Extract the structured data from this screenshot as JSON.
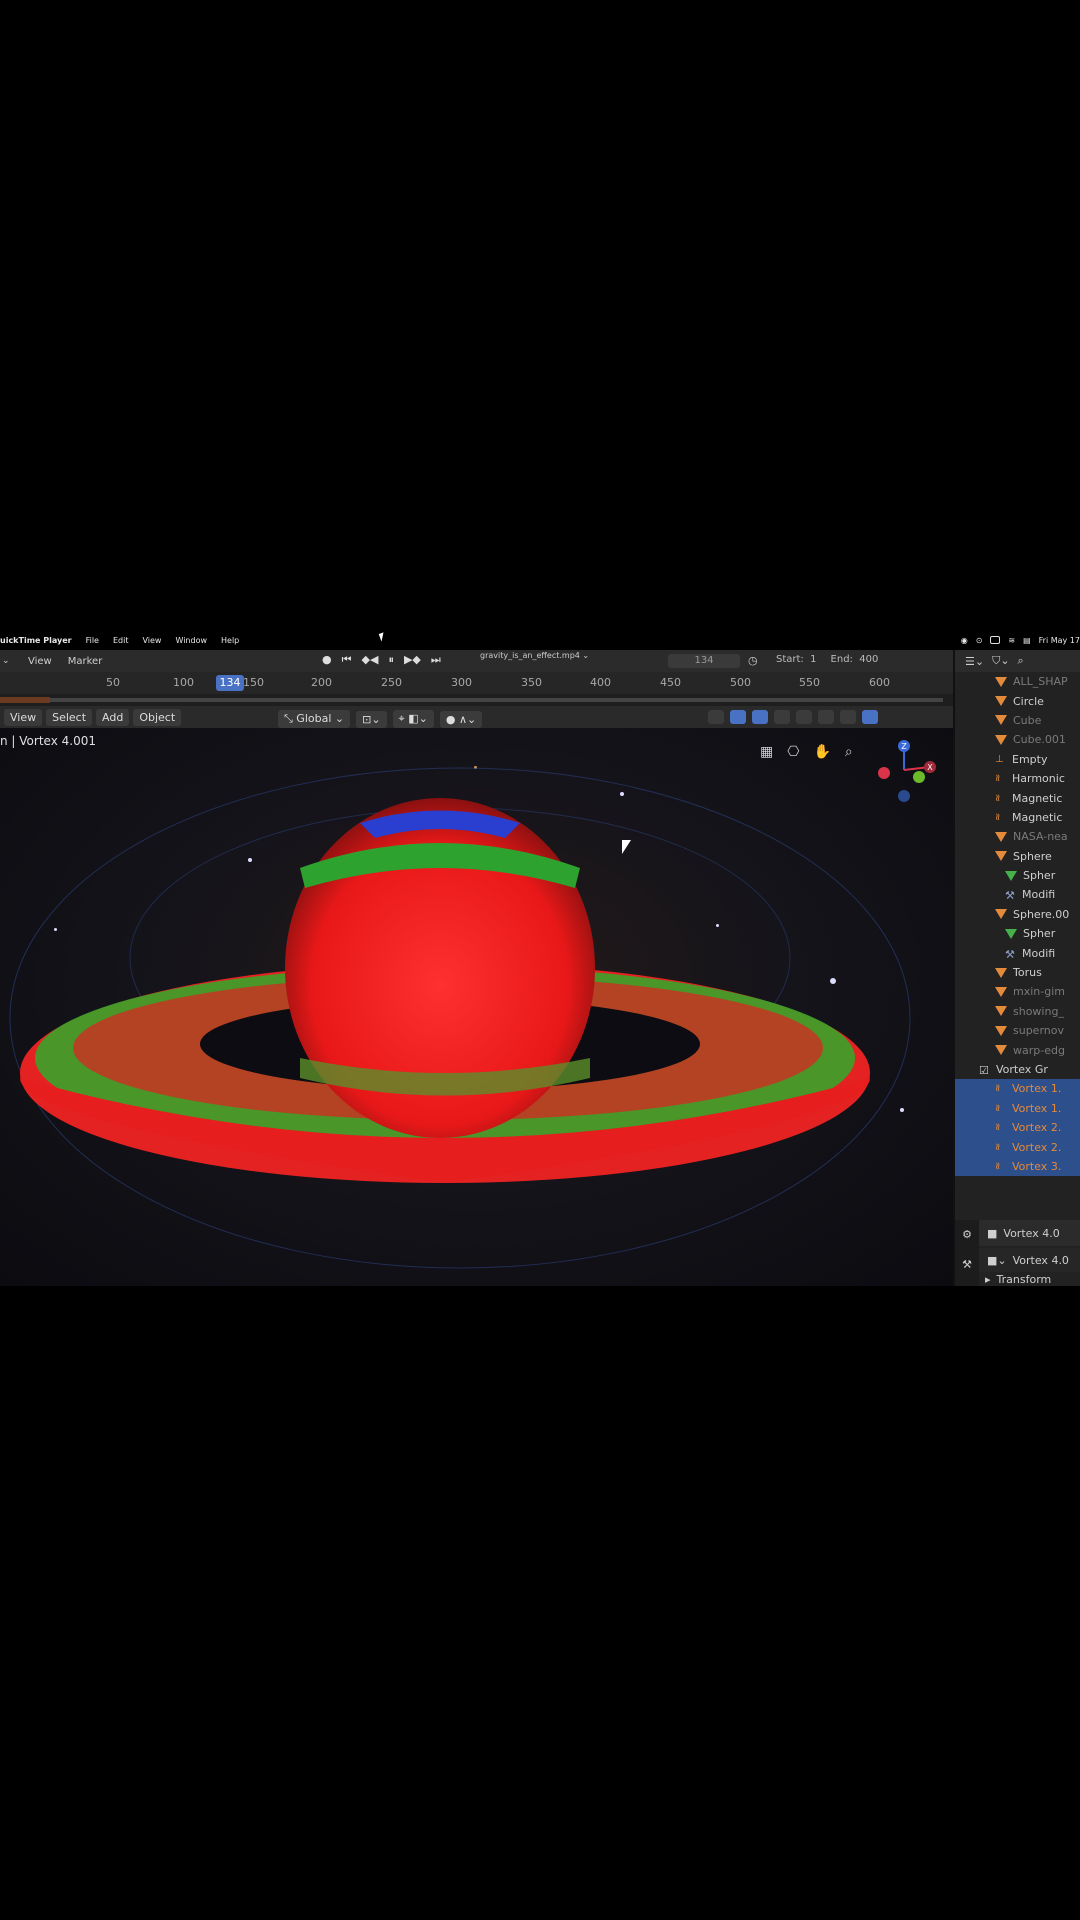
{
  "menubar": {
    "app_name": "uickTime Player",
    "items": [
      "File",
      "Edit",
      "View",
      "Window",
      "Help"
    ],
    "clock": "Fri May 17"
  },
  "video": {
    "file_title": "gravity_is_an_effect.mp4 ⌄",
    "timeline": {
      "view_label": "View",
      "marker_label": "Marker",
      "current_frame": "134",
      "start_label": "Start:",
      "start_value": "1",
      "end_label": "End:",
      "end_value": "400",
      "ruler_ticks": [
        "50",
        "100",
        "150",
        "200",
        "250",
        "300",
        "350",
        "400",
        "450",
        "500",
        "550",
        "600"
      ]
    },
    "viewport_header": {
      "menus": [
        "View",
        "Select",
        "Add",
        "Object"
      ],
      "transform_orientation": "Global"
    },
    "viewport": {
      "title": "n | Vortex 4.001",
      "gizmo_axes": [
        "Z",
        "X"
      ]
    },
    "outliner": {
      "items": [
        {
          "name": "ALL_SHAP",
          "type": "mesh",
          "dim": true
        },
        {
          "name": "Circle",
          "type": "mesh",
          "dim": false
        },
        {
          "name": "Cube",
          "type": "mesh",
          "dim": true
        },
        {
          "name": "Cube.001",
          "type": "mesh",
          "dim": true
        },
        {
          "name": "Empty",
          "type": "empty",
          "dim": false
        },
        {
          "name": "Harmonic",
          "type": "force",
          "dim": false
        },
        {
          "name": "Magnetic",
          "type": "force",
          "dim": false
        },
        {
          "name": "Magnetic",
          "type": "force",
          "dim": false
        },
        {
          "name": "NASA-nea",
          "type": "mesh",
          "dim": true
        },
        {
          "name": "Sphere",
          "type": "mesh",
          "dim": false
        },
        {
          "name": "Spher",
          "type": "meshdata",
          "dim": false
        },
        {
          "name": "Modifi",
          "type": "modifier",
          "dim": false
        },
        {
          "name": "Sphere.00",
          "type": "mesh",
          "dim": false
        },
        {
          "name": "Spher",
          "type": "meshdata",
          "dim": false
        },
        {
          "name": "Modifi",
          "type": "modifier",
          "dim": false
        },
        {
          "name": "Torus",
          "type": "mesh",
          "dim": false
        },
        {
          "name": "mxin-gim",
          "type": "mesh",
          "dim": true
        },
        {
          "name": "showing_",
          "type": "mesh",
          "dim": true
        },
        {
          "name": "supernov",
          "type": "mesh",
          "dim": true
        },
        {
          "name": "warp-edg",
          "type": "mesh",
          "dim": true
        },
        {
          "name": "Vortex Gr",
          "type": "collection",
          "dim": false
        },
        {
          "name": "Vortex 1.",
          "type": "force",
          "dim": false,
          "selected": true
        },
        {
          "name": "Vortex 1.",
          "type": "force",
          "dim": false,
          "selected": true
        },
        {
          "name": "Vortex 2.",
          "type": "force",
          "dim": false,
          "selected": true
        },
        {
          "name": "Vortex 2.",
          "type": "force",
          "dim": false,
          "selected": true
        },
        {
          "name": "Vortex 3.",
          "type": "force",
          "dim": false,
          "selected": true
        }
      ]
    },
    "properties": {
      "object_name": "Vortex 4.0",
      "data_name": "Vortex 4.0",
      "section": "Transform"
    }
  }
}
